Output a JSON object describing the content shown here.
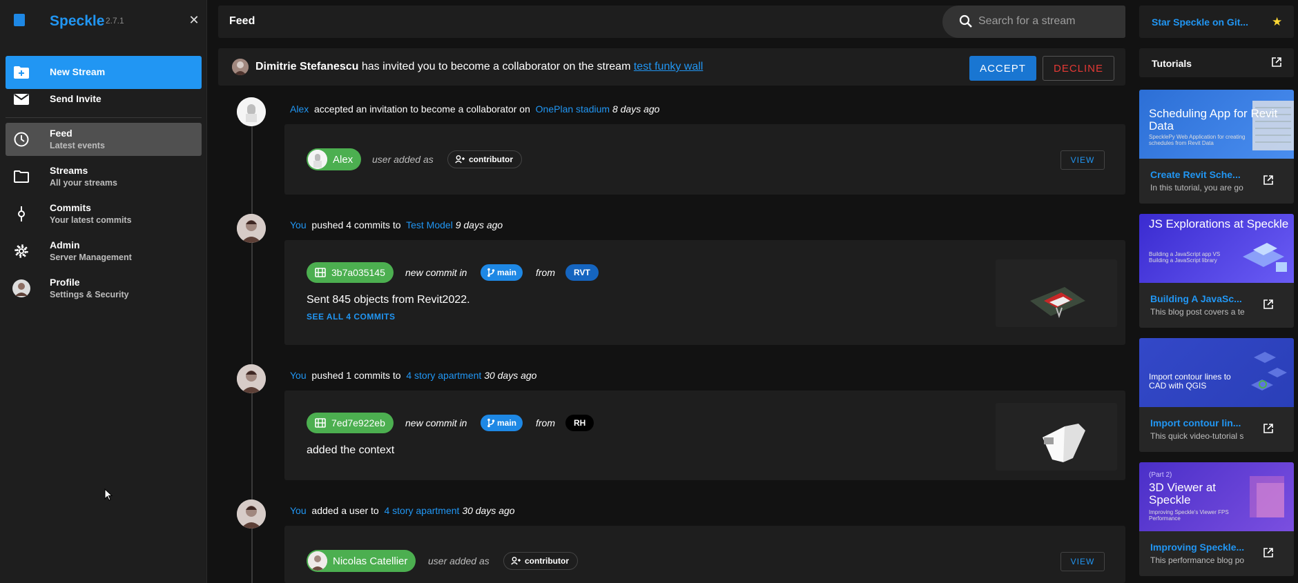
{
  "app": {
    "name": "Speckle",
    "version": "2.7.1"
  },
  "sidebar": {
    "items": [
      {
        "title": "New Stream",
        "subtitle": ""
      },
      {
        "title": "Send Invite",
        "subtitle": ""
      },
      {
        "title": "Feed",
        "subtitle": "Latest events"
      },
      {
        "title": "Streams",
        "subtitle": "All your streams"
      },
      {
        "title": "Commits",
        "subtitle": "Your latest commits"
      },
      {
        "title": "Admin",
        "subtitle": "Server Management"
      },
      {
        "title": "Profile",
        "subtitle": "Settings & Security"
      }
    ]
  },
  "topbar": {
    "title": "Feed",
    "search_placeholder": "Search for a stream"
  },
  "invite": {
    "inviter": "Dimitrie Stefanescu",
    "text": "has invited you to become a collaborator on the stream",
    "stream": "test funky wall",
    "accept_label": "ACCEPT",
    "decline_label": "DECLINE"
  },
  "feed": {
    "events": [
      {
        "actor": "Alex",
        "action": "accepted an invitation to become a collaborator on",
        "stream": "OnePlan stadium",
        "time": "8 days ago",
        "user_chip": "Alex",
        "added_as": "user added as",
        "role": "contributor",
        "view_label": "VIEW"
      },
      {
        "actor": "You",
        "action": "pushed 4 commits to",
        "stream": "Test Model",
        "time": "9 days ago",
        "commit_id": "3b7a035145",
        "new_commit_in": "new commit in",
        "branch": "main",
        "from": "from",
        "source": "RVT",
        "message": "Sent 845 objects from Revit2022.",
        "see_all": "SEE ALL 4 COMMITS"
      },
      {
        "actor": "You",
        "action": "pushed 1 commits to",
        "stream": "4 story apartment",
        "time": "30 days ago",
        "commit_id": "7ed7e922eb",
        "new_commit_in": "new commit in",
        "branch": "main",
        "from": "from",
        "source": "RH",
        "message": "added the context"
      },
      {
        "actor": "You",
        "action": "added a user to",
        "stream": "4 story apartment",
        "time": "30 days ago",
        "user_chip": "Nicolas Catellier",
        "added_as": "user added as",
        "role": "contributor",
        "view_label": "VIEW"
      }
    ]
  },
  "right_panel": {
    "star_label": "Star Speckle on Git...",
    "tutorials_label": "Tutorials",
    "tutorials": [
      {
        "image_title": "Scheduling App for Revit Data",
        "image_sub": "SpecklePy Web Application for creating schedules from Revit Data",
        "title": "Create Revit Sche...",
        "desc": "In this tutorial, you are go"
      },
      {
        "image_title": "JS Explorations at Speckle",
        "image_sub": "Building a JavaScript app VS Building a JavaScript library",
        "title": "Building A JavaSc...",
        "desc": "This blog post covers a te"
      },
      {
        "image_title": "Import contour lines to CAD with QGIS",
        "image_sub": "",
        "title": "Import contour lin...",
        "desc": "This quick video-tutorial s"
      },
      {
        "image_title": "3D Viewer at Speckle",
        "image_pre": "(Part 2)",
        "image_sub": "Improving Speckle's Viewer FPS Performance",
        "title": "Improving Speckle...",
        "desc": "This performance blog po"
      }
    ]
  },
  "colors": {
    "accent": "#2196f3",
    "success": "#4caf50",
    "danger": "#e53935",
    "background": "#121212",
    "surface": "#1e1e1e"
  }
}
